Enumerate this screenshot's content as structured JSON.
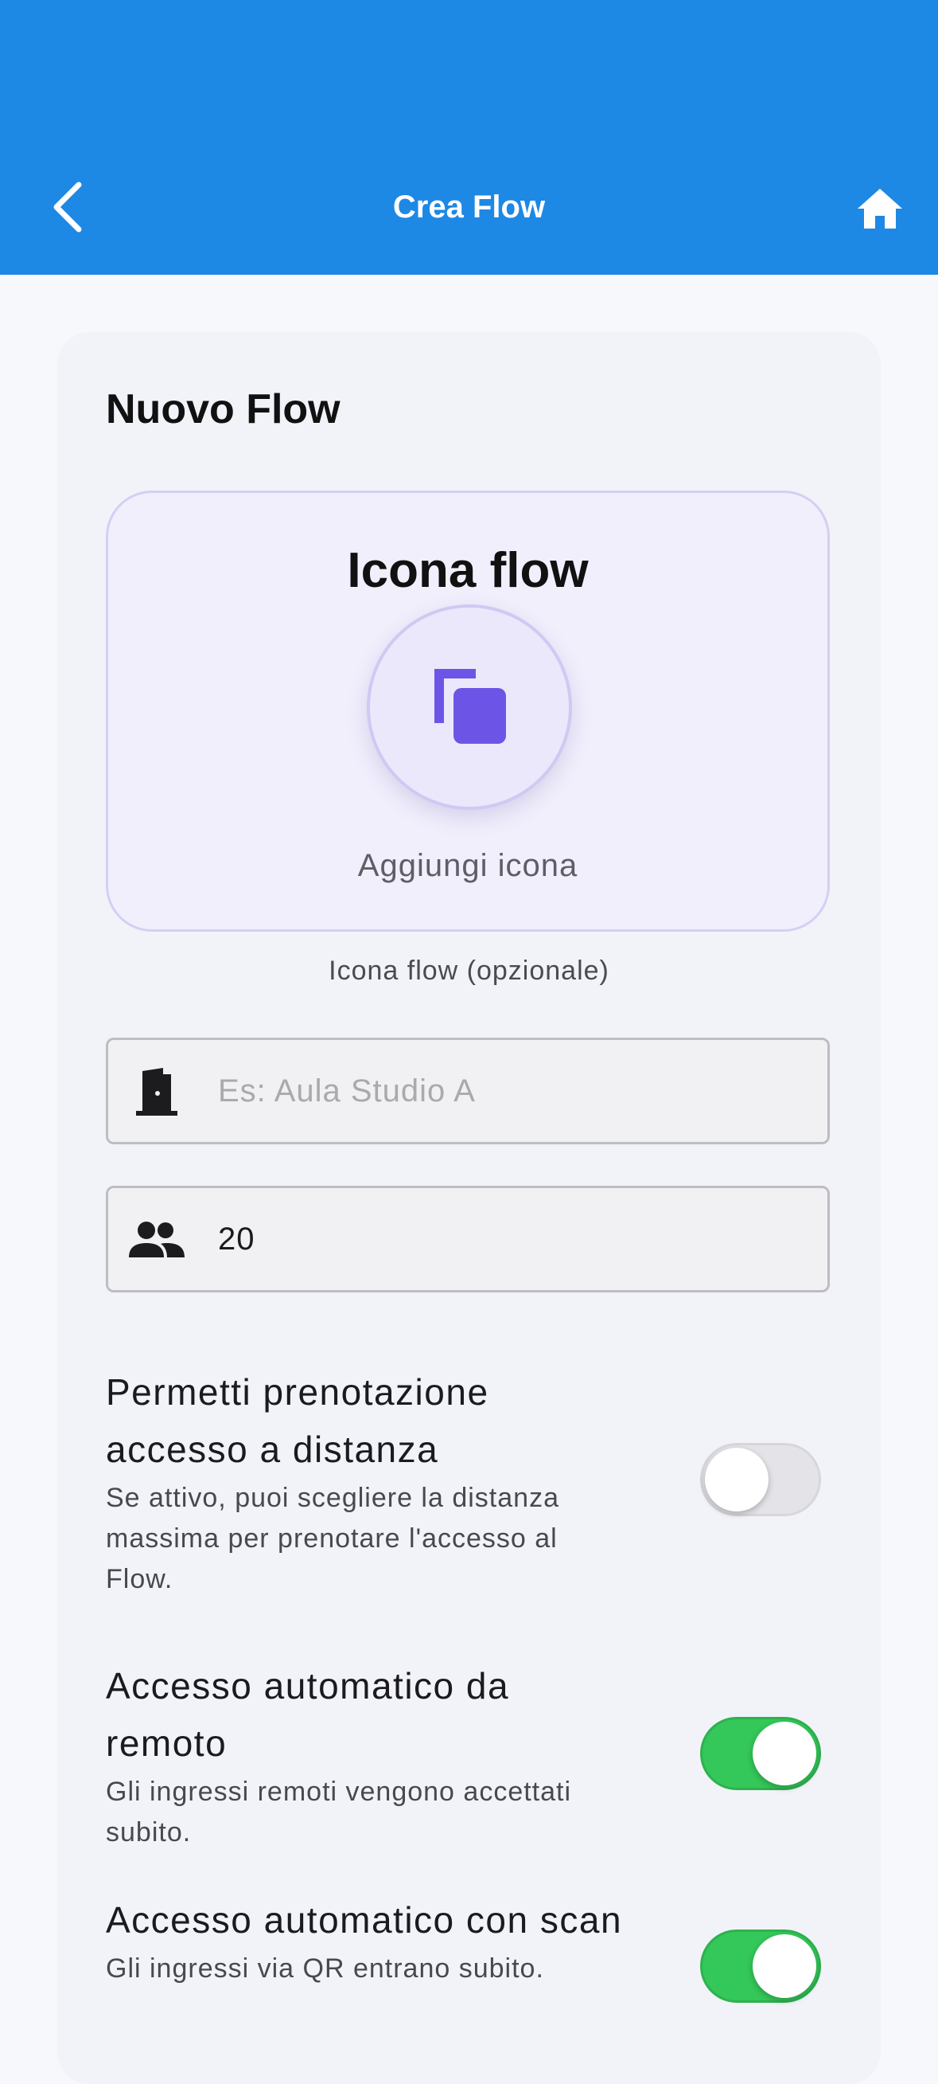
{
  "app_bar": {
    "title": "Crea Flow",
    "back_icon": "chevron-left-icon",
    "home_icon": "home-icon",
    "background": "#1e88e5"
  },
  "form": {
    "title": "Nuovo Flow",
    "icon_picker": {
      "title": "Icona flow",
      "icon": "copy-icon",
      "add_label": "Aggiungi icona",
      "caption": "Icona flow (opzionale)",
      "accent": "#6c55e6"
    },
    "name_field": {
      "icon": "door-icon",
      "placeholder": "Es: Aula Studio A",
      "value": ""
    },
    "capacity_field": {
      "icon": "people-icon",
      "value": "20"
    },
    "settings": [
      {
        "title": "Permetti prenotazione accesso a distanza",
        "description": "Se attivo, puoi scegliere la distanza massima per prenotare l'accesso al Flow.",
        "enabled": false
      },
      {
        "title": "Accesso automatico da remoto",
        "description": "Gli ingressi remoti vengono accettati subito.",
        "enabled": true
      },
      {
        "title": "Accesso automatico con scan",
        "description": "Gli ingressi via QR entrano subito.",
        "enabled": true
      }
    ],
    "toggle_on_color": "#34c759"
  }
}
